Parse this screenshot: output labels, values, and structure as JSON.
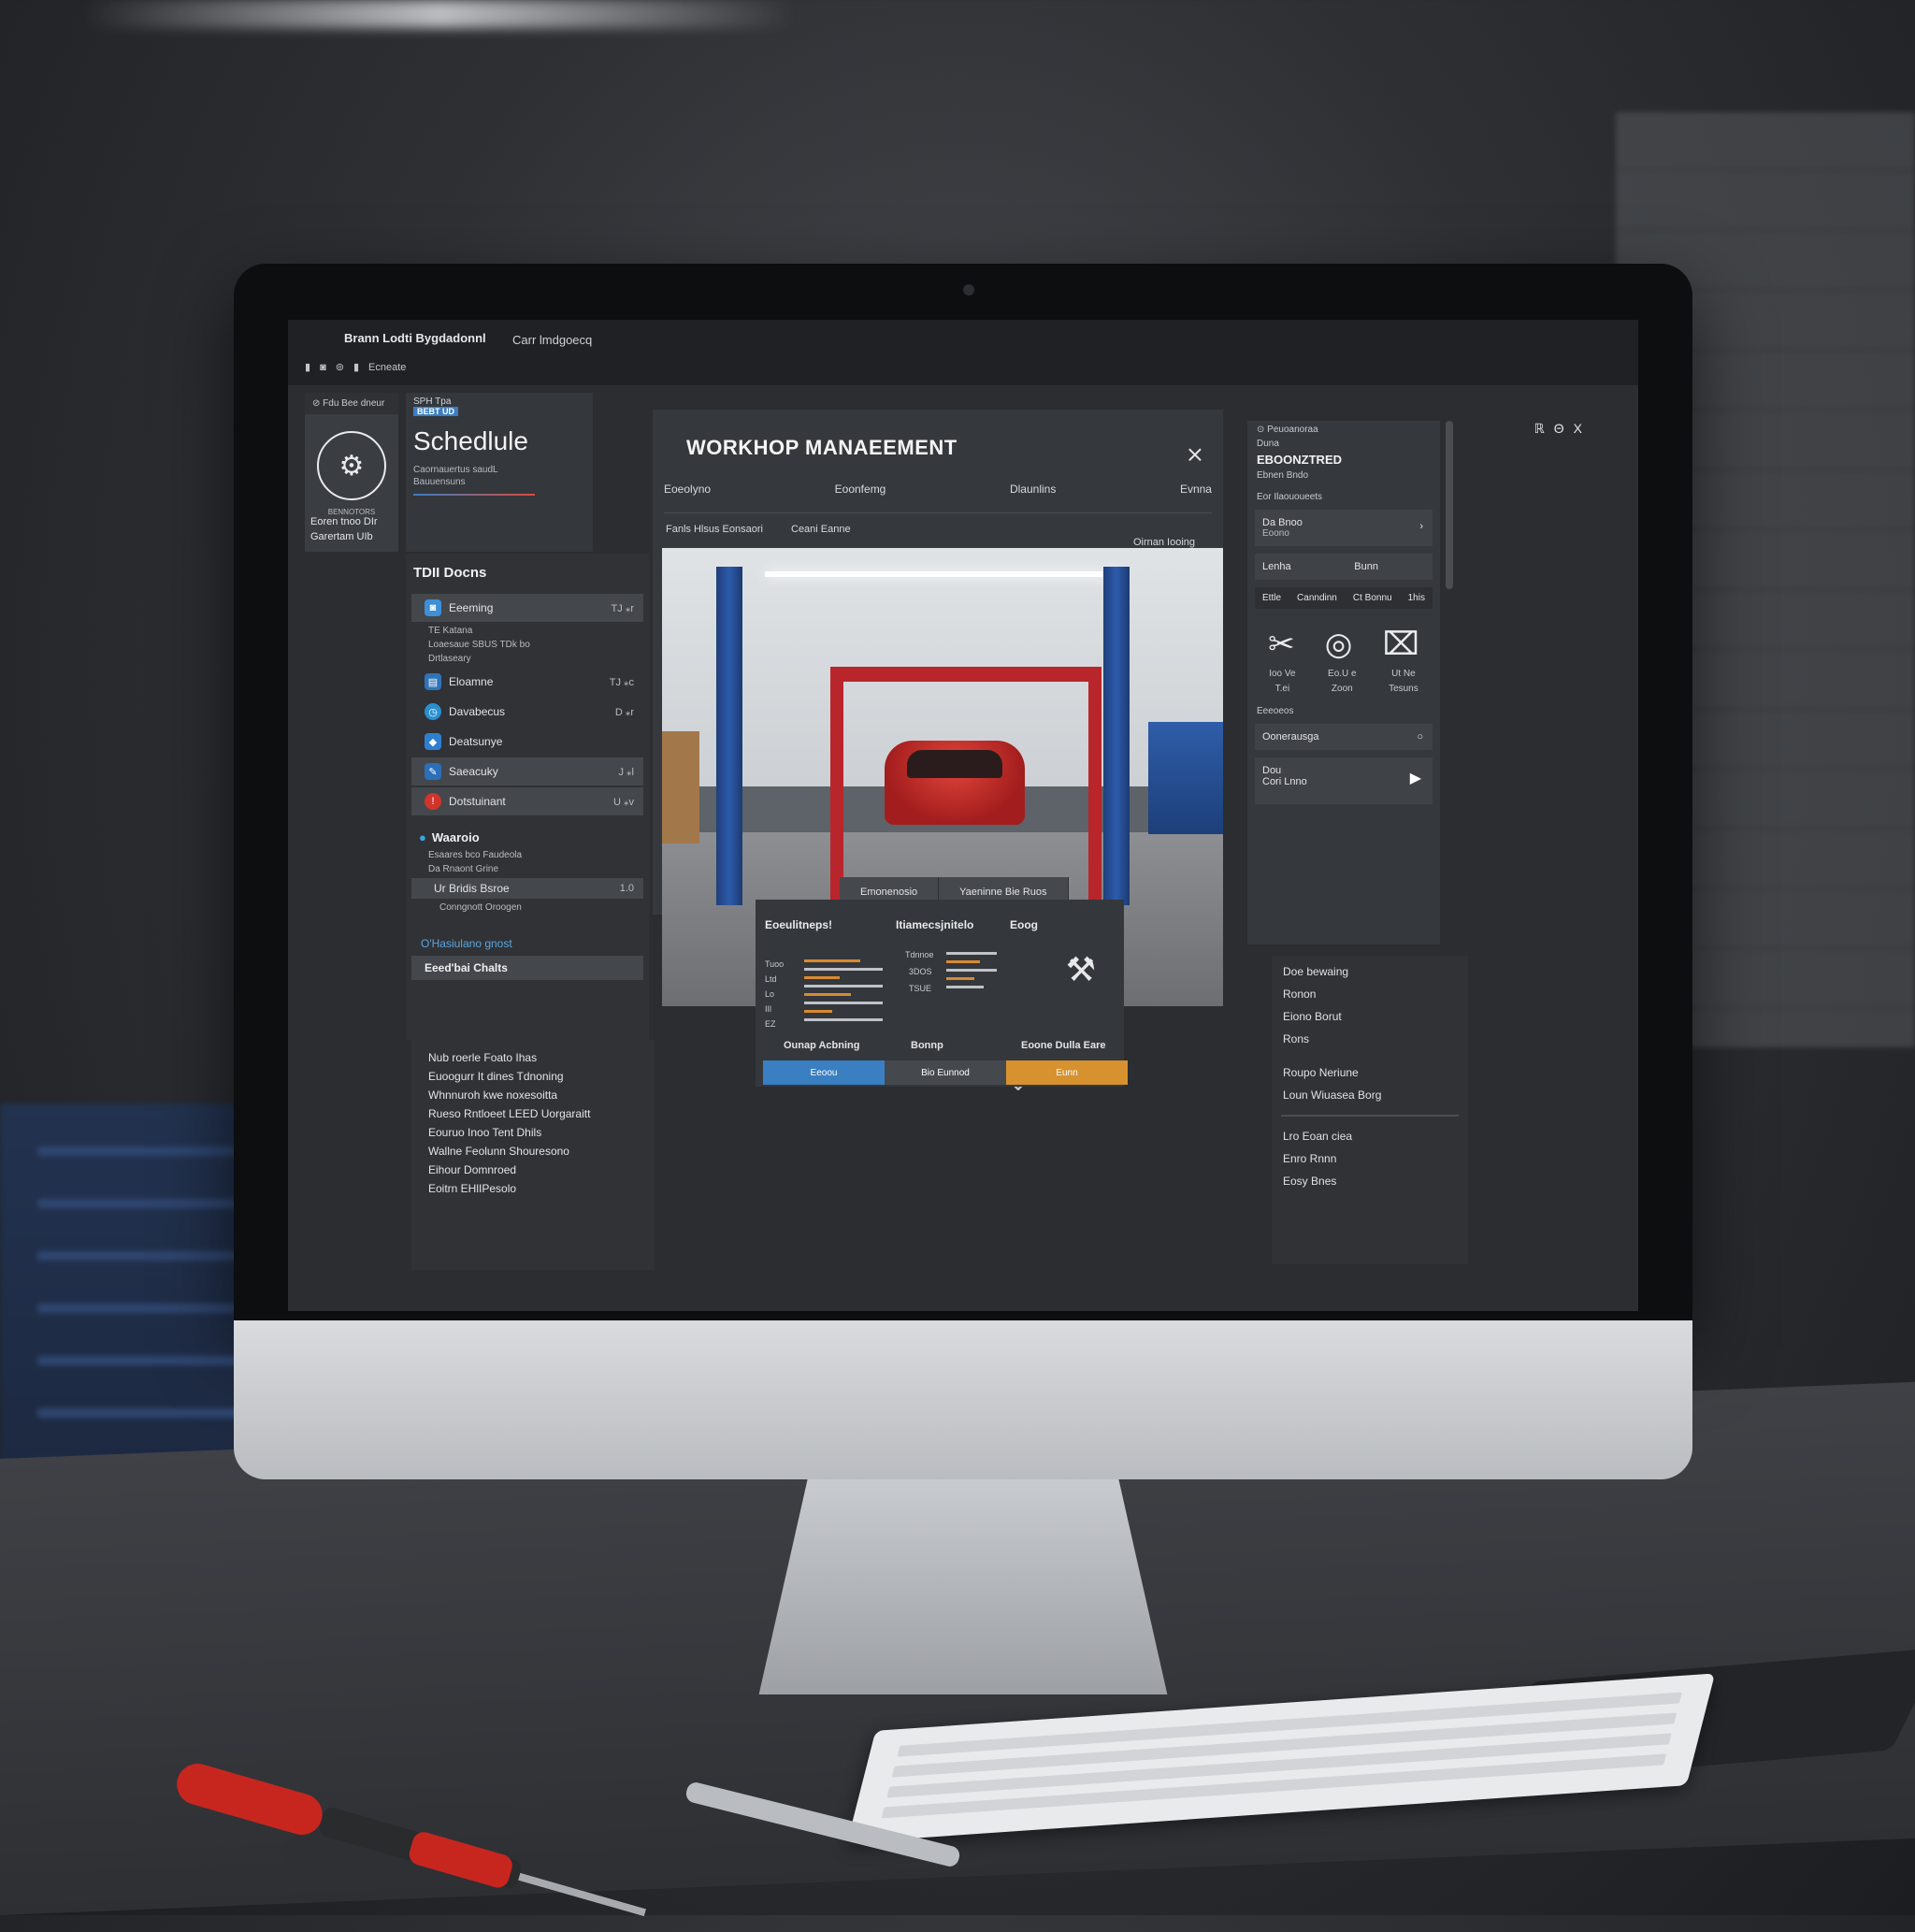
{
  "menubar": {
    "title": "Brann Lodti Bygdadonnl",
    "subtitle": "Carr lmdgoecq",
    "tools": [
      "▮",
      "◙",
      "⊚",
      "▮",
      "Ecneate"
    ]
  },
  "window_controls": [
    "ℝ",
    "Θ",
    "X"
  ],
  "colA": {
    "header": "⊘ Fdu Bee dneur",
    "caption": "BENNOTORS",
    "footer_1": "Eoren tnoo  DIr",
    "footer_2": "Garertam  UIb"
  },
  "schedule": {
    "tag": "SPH Tpa",
    "badge": "BEBT UD",
    "title": "Schedlule",
    "subtitle_1": "Caornauertus saudL",
    "subtitle_2": "Bauuensuns"
  },
  "tasks": {
    "title": "TDII Docns",
    "items": [
      {
        "label": "Eeeming",
        "value": "TJ ⁎r",
        "color": "#3d8fd6",
        "hl": true
      },
      {
        "label": "Eloamne",
        "value": "TJ ⁎c",
        "color": "#2f74b8",
        "hl": false
      },
      {
        "label": "Davabecus",
        "value": "D ⁎r",
        "color": "#2a8fd0",
        "hl": false
      },
      {
        "label": "Deatsunye",
        "value": "",
        "color": "#2f7ed0",
        "hl": false
      },
      {
        "label": "Saeacuky",
        "value": "J ⁎l",
        "color": "#2a6fb8",
        "hl": true
      },
      {
        "label": "Dotstuinant",
        "value": "U ⁎v",
        "color": "#d0342b",
        "hl": true
      }
    ],
    "subitems": [
      "TE Katana",
      "Loaesaue    SBUS TDk bo",
      "Drtlaseary"
    ],
    "section": "Waaroio",
    "section_items": [
      "Esaares bco Faudeola",
      "Da Rnaont Grine",
      "Ur Bridis Bsroe",
      "Conngnott Oroogen"
    ],
    "section_value": "1.0",
    "link": "O'Hasiulano gnost",
    "btnbar": "Eeed'bai Chalts",
    "bottom_items": [
      "Nub roerle Foato Ihas",
      "Euoogurr It dines Tdnoning",
      "Whnnuroh kwe noxesoitta",
      "Rueso Rntloeet LEED Uorgaraitt",
      "Eouruo Inoo Tent Dhils",
      "Wallne Feolunn Shouresono",
      "Eihour Domnroed",
      "Eoitrn EHlIPesolo"
    ]
  },
  "main": {
    "title": "WORKHOP MANAEEMENT",
    "tabs": [
      "Eoeolyno",
      "Eoonfemg",
      "Dlaunlins",
      "Evnna"
    ],
    "crumb_1": "Fanls Hlsus Eonsaori",
    "crumb_2": "Ceani Eanne",
    "crumb_3": "Oirnan Iooing",
    "photo_buttons": [
      "Emonenosio",
      "Yaeninne Bie Ruos"
    ]
  },
  "stats": {
    "headers": [
      "Eoeulitneps!",
      "Itiamecsjnitelo",
      "Eoog"
    ],
    "ylabels_left": [
      "Tuoo",
      "Ltd",
      "Lo",
      "IIl",
      "EZ"
    ],
    "ylabels_mid": [
      "Tdnnoe",
      "3DOS",
      "TSUE"
    ],
    "footers": [
      "Ounap Acbning",
      "Bonnp",
      "Eoone Dulla Eare"
    ],
    "buttons": [
      {
        "label": "Eeoou",
        "color": "#3a7fc1"
      },
      {
        "label": "Bio Eunnod",
        "color": "#45484d"
      },
      {
        "label": "Eunn",
        "color": "#d8912f"
      }
    ]
  },
  "right": {
    "small_1": "⊙ Peuoanoraa",
    "small_2": "Duna",
    "big": "EBOONZTRED",
    "small_3": "Ebnen Bndo",
    "small_4": "Eor Ilaououeets",
    "box_1_l1": "Da Bnoo",
    "box_1_l2": "Eoono",
    "box_2_l": "Lenha",
    "box_2_r": "Bunn",
    "strip": [
      "Ettle",
      "Canndinn",
      "Ct Bonnu",
      "1his"
    ],
    "icon_labels": [
      [
        "Ioo Ve",
        "T.ei"
      ],
      [
        "Eo.U e",
        "Zoon"
      ],
      [
        "Ut Ne",
        "Tesuns"
      ]
    ],
    "section": "Eeeoeos",
    "box_3": "Oonerausga",
    "box_4_l1": "Dou",
    "box_4_l2": "Cori Lnno"
  },
  "right2": {
    "items_a": [
      "Doe bewaing",
      "Ronon",
      "Eiono Borut",
      "Rons"
    ],
    "items_b": [
      "Roupo Neriune",
      "Loun Wiuasea Borg"
    ],
    "items_c": [
      "Lro Eoan ciea",
      "Enro Rnnn",
      "Eosy Bnes"
    ]
  }
}
